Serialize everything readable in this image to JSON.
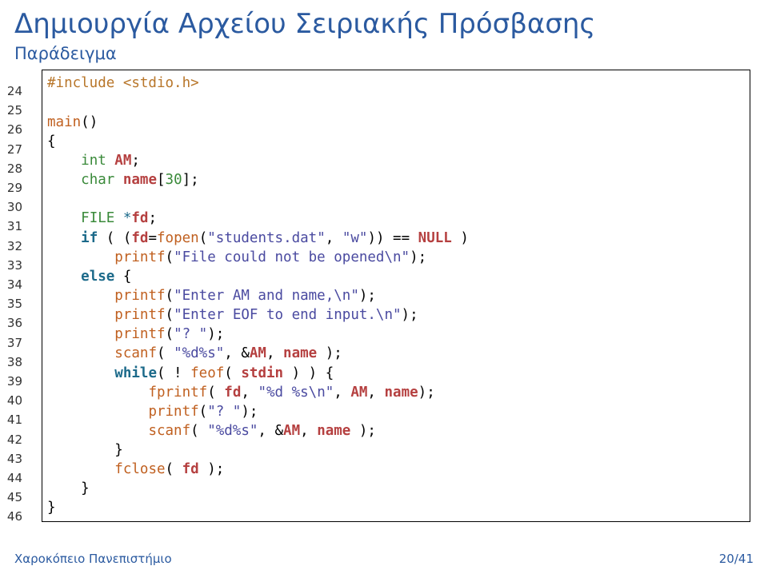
{
  "title": "Δημιουργία Αρχείου Σειριακής Πρόσβασης",
  "subtitle": "Παράδειγμα",
  "line_numbers": [
    "24",
    "25",
    "26",
    "27",
    "28",
    "29",
    "30",
    "31",
    "32",
    "33",
    "34",
    "35",
    "36",
    "37",
    "38",
    "39",
    "40",
    "41",
    "42",
    "43",
    "44",
    "45",
    "46"
  ],
  "code": {
    "l0_inc": "#include <stdio.h>",
    "l2_main": "main",
    "l2_paren": "()",
    "l3_brace": "{",
    "l4_int": "int",
    "l4_am": " AM",
    "l4_semi": ";",
    "l5_char": "char",
    "l5_name": " name",
    "l5_br": "[",
    "l5_30": "30",
    "l5_ket": "];",
    "l7_file": "FILE",
    "l7_star": " *",
    "l7_fd": "fd",
    "l7_semi": ";",
    "l8_if": "if",
    "l8_p1": " ( (",
    "l8_fd": "fd",
    "l8_eq": "=",
    "l8_fopen": "fopen",
    "l8_p2": "(",
    "l8_str1": "\"students.dat\"",
    "l8_comma": ", ",
    "l8_str2": "\"w\"",
    "l8_p3": ")) == ",
    "l8_null": "NULL",
    "l8_p4": " )",
    "l9_printf": "printf",
    "l9_p1": "(",
    "l9_str": "\"File could not be opened\\n\"",
    "l9_p2": ");",
    "l10_else": "else",
    "l10_brace": " {",
    "l11_printf": "printf",
    "l11_p1": "(",
    "l11_str": "\"Enter AM and name,\\n\"",
    "l11_p2": ");",
    "l12_printf": "printf",
    "l12_p1": "(",
    "l12_str": "\"Enter EOF to end input.\\n\"",
    "l12_p2": ");",
    "l13_printf": "printf",
    "l13_p1": "(",
    "l13_str": "\"? \"",
    "l13_p2": ");",
    "l14_scanf": "scanf",
    "l14_p1": "( ",
    "l14_str": "\"%d%s\"",
    "l14_comma": ", &",
    "l14_am": "AM",
    "l14_c2": ", ",
    "l14_name": "name",
    "l14_p2": " );",
    "l15_while": "while",
    "l15_p1": "( ! ",
    "l15_feof": "feof",
    "l15_p2": "( ",
    "l15_stdin": "stdin",
    "l15_p3": " ) ) {",
    "l16_fprintf": "fprintf",
    "l16_p1": "( ",
    "l16_fd": "fd",
    "l16_c1": ", ",
    "l16_str": "\"%d %s\\n\"",
    "l16_c2": ", ",
    "l16_am": "AM",
    "l16_c3": ", ",
    "l16_name": "name",
    "l16_p2": ");",
    "l17_printf": "printf",
    "l17_p1": "(",
    "l17_str": "\"? \"",
    "l17_p2": ");",
    "l18_scanf": "scanf",
    "l18_p1": "( ",
    "l18_str": "\"%d%s\"",
    "l18_c1": ", &",
    "l18_am": "AM",
    "l18_c2": ", ",
    "l18_name": "name",
    "l18_p2": " );",
    "l19_brace": "}",
    "l20_fclose": "fclose",
    "l20_p1": "( ",
    "l20_fd": "fd",
    "l20_p2": " );",
    "l21_brace": "}",
    "l22_brace": "}"
  },
  "footer": {
    "left": "Χαροκόπειο Πανεπιστήμιο",
    "right": "20/41"
  }
}
